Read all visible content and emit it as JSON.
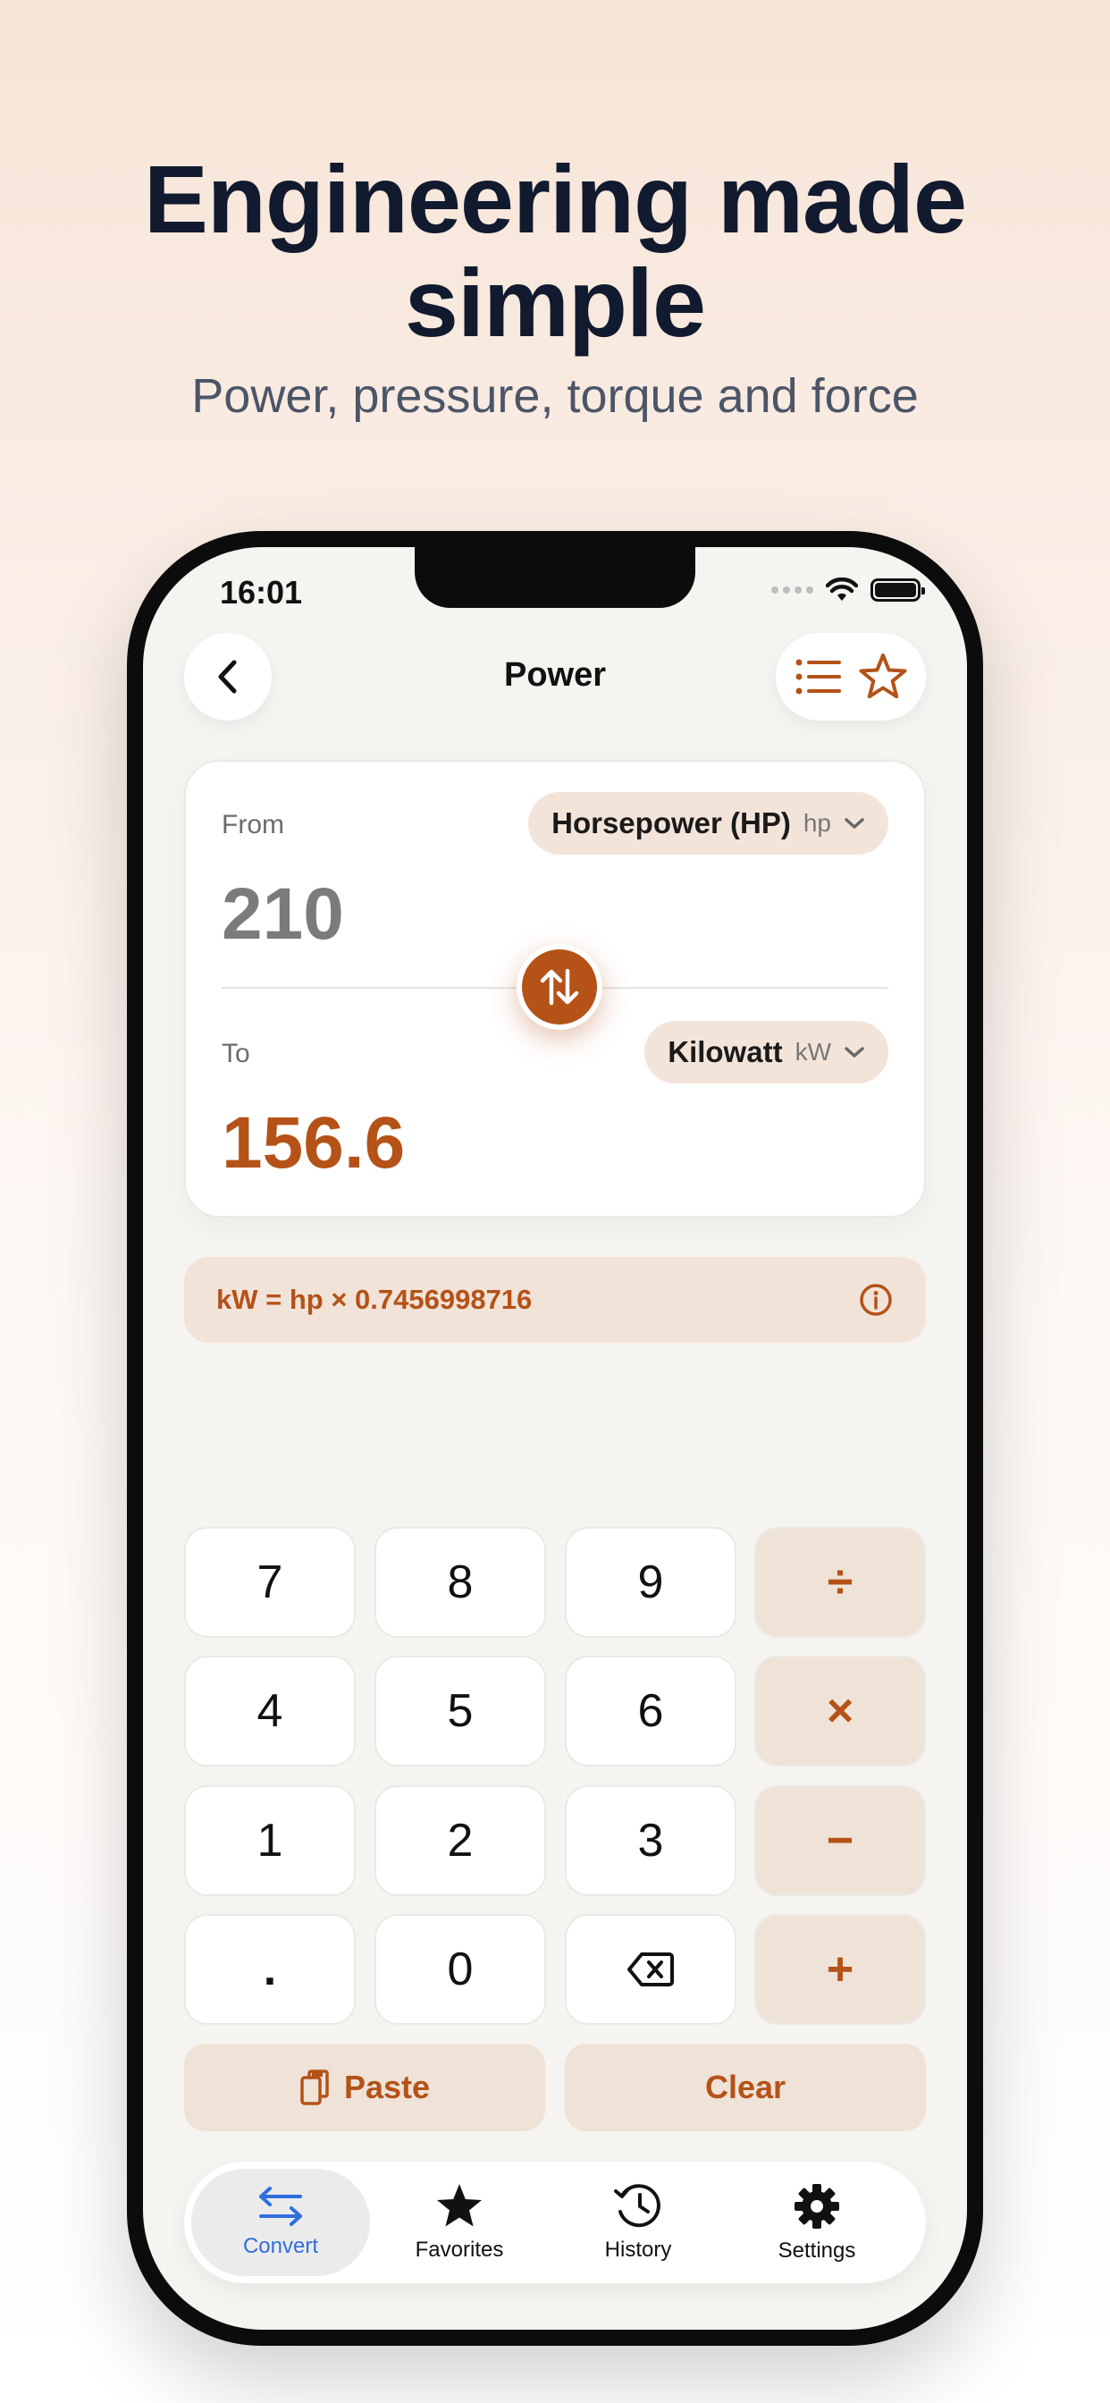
{
  "marketing": {
    "headline_line1": "Engineering made",
    "headline_line2": "simple",
    "subheadline": "Power, pressure, torque and force"
  },
  "status_bar": {
    "time": "16:01"
  },
  "nav": {
    "title": "Power"
  },
  "converter": {
    "from_label": "From",
    "from_unit_name": "Horsepower (HP)",
    "from_unit_symbol": "hp",
    "from_value": "210",
    "to_label": "To",
    "to_unit_name": "Kilowatt",
    "to_unit_symbol": "kW",
    "to_value": "156.6"
  },
  "formula": {
    "text": "kW = hp × 0.7456998716"
  },
  "keypad": {
    "k7": "7",
    "k8": "8",
    "k9": "9",
    "divide": "÷",
    "k4": "4",
    "k5": "5",
    "k6": "6",
    "multiply": "×",
    "k1": "1",
    "k2": "2",
    "k3": "3",
    "minus": "−",
    "dot": ".",
    "k0": "0",
    "plus": "+",
    "paste": "Paste",
    "clear": "Clear"
  },
  "tabs": [
    {
      "label": "Convert",
      "icon": "arrows-left-right-icon",
      "active": true
    },
    {
      "label": "Favorites",
      "icon": "star-icon",
      "active": false
    },
    {
      "label": "History",
      "icon": "history-icon",
      "active": false
    },
    {
      "label": "Settings",
      "icon": "gear-icon",
      "active": false
    }
  ],
  "colors": {
    "accent": "#b45218",
    "tab_active": "#2f6fde",
    "headline": "#111a2e"
  }
}
